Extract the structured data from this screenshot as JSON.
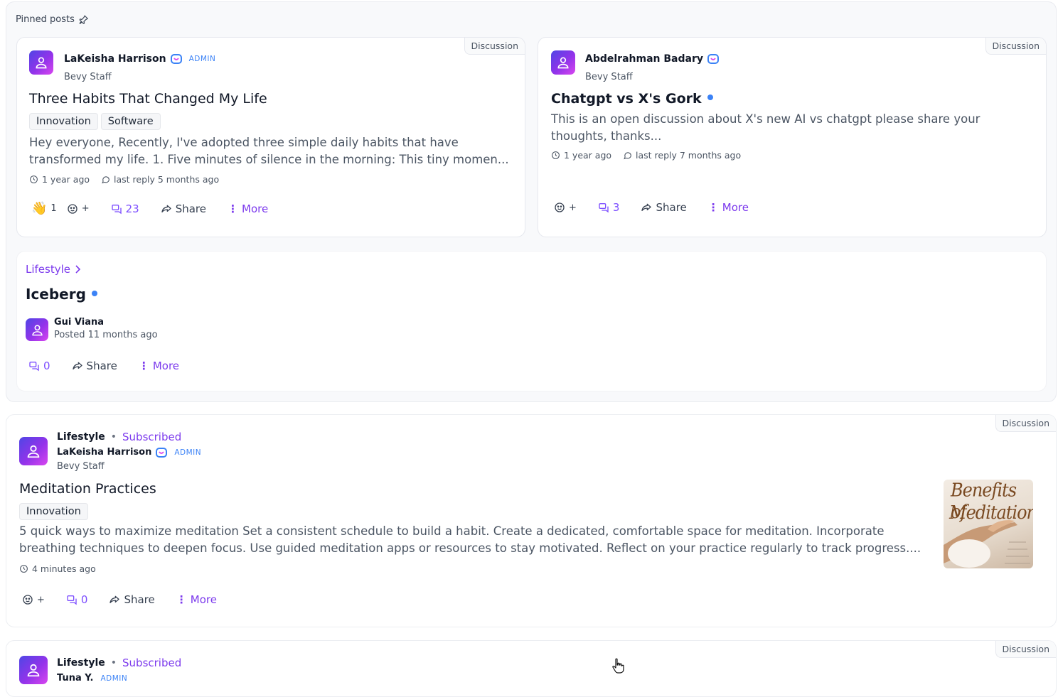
{
  "pinned": {
    "header": "Pinned posts",
    "cards": [
      {
        "badge": "Discussion",
        "author": "LaKeisha Harrison",
        "admin_label": "ADMIN",
        "role": "Bevy Staff",
        "title": "Three Habits That Changed My Life",
        "tags": [
          "Innovation",
          "Software"
        ],
        "excerpt": "Hey everyone, Recently, I've adopted three simple daily habits that have transformed my life. 1. Five minutes of silence in the morning: This tiny momen...",
        "posted": "1 year ago",
        "last_reply": "last reply 5 months ago",
        "reaction_count": "1",
        "react_plus": "+",
        "comments": "23",
        "share": "Share",
        "more": "More"
      },
      {
        "badge": "Discussion",
        "author": "Abdelrahman Badary",
        "role": "Bevy Staff",
        "title": "Chatgpt vs X's Gork",
        "excerpt": "This is an open discussion about X's new AI vs chatgpt please share your thoughts, thanks...",
        "posted": "1 year ago",
        "last_reply": "last reply 7 months ago",
        "react_plus": "+",
        "comments": "3",
        "share": "Share",
        "more": "More"
      }
    ],
    "wide": {
      "crumb": "Lifestyle",
      "title": "Iceberg",
      "author": "Gui Viana",
      "posted": "Posted 11 months ago",
      "comments": "0",
      "share": "Share",
      "more": "More"
    }
  },
  "feed": [
    {
      "badge": "Discussion",
      "category": "Lifestyle",
      "subscribed": "Subscribed",
      "author": "LaKeisha Harrison",
      "admin_label": "ADMIN",
      "role": "Bevy Staff",
      "title": "Meditation Practices",
      "tags": [
        "Innovation"
      ],
      "excerpt": "5 quick ways to maximize meditation Set a consistent schedule to build a habit. Create a dedicated, comfortable space for meditation. Incorporate breathing techniques to deepen focus. Use guided meditation apps or resources to stay motivated. Reflect on your practice regularly to track progress....",
      "posted": "4 minutes ago",
      "react_plus": "+",
      "comments": "0",
      "share": "Share",
      "more": "More",
      "thumbnail_text": [
        "Benefits of",
        "Meditation"
      ]
    },
    {
      "badge": "Discussion",
      "category": "Lifestyle",
      "subscribed": "Subscribed",
      "author": "Tuna Y.",
      "admin_label": "ADMIN"
    }
  ],
  "colors": {
    "accent": "#7c3aed",
    "admin_blue": "#3b82f6",
    "avatar_gradient": [
      "#4f46e5",
      "#9333ea",
      "#d946ef"
    ]
  }
}
